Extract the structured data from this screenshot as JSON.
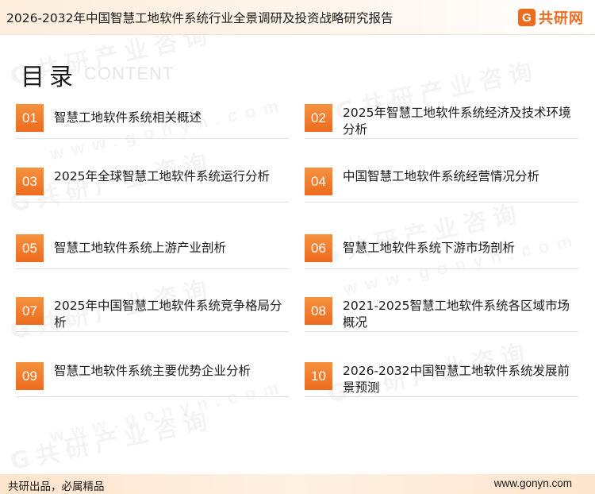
{
  "header": {
    "report_title": "2026-2032年中国智慧工地软件系统行业全景调研及投资战略研究报告",
    "brand_icon_letter": "G",
    "brand_name": "共研网"
  },
  "toc": {
    "heading": "目录",
    "subheading": "CONTENT",
    "items": [
      {
        "num": "01",
        "title": "智慧工地软件系统相关概述"
      },
      {
        "num": "02",
        "title": "2025年智慧工地软件系统经济及技术环境分析"
      },
      {
        "num": "03",
        "title": "2025年全球智慧工地软件系统运行分析"
      },
      {
        "num": "04",
        "title": "中国智慧工地软件系统经营情况分析"
      },
      {
        "num": "05",
        "title": "智慧工地软件系统上游产业剖析"
      },
      {
        "num": "06",
        "title": "智慧工地软件系统下游市场剖析"
      },
      {
        "num": "07",
        "title": "2025年中国智慧工地软件系统竞争格局分析"
      },
      {
        "num": "08",
        "title": "2021-2025智慧工地软件系统各区域市场概况"
      },
      {
        "num": "09",
        "title": "智慧工地软件系统主要优势企业分析"
      },
      {
        "num": "10",
        "title": "2026-2032中国智慧工地软件系统发展前景预测"
      }
    ]
  },
  "watermark": {
    "text": "G共研产业咨询",
    "url": "www.gonyn.com"
  },
  "footer": {
    "slogan": "共研出品，必属精品",
    "url": "www.gonyn.com"
  },
  "colors": {
    "accent": "#ee6b1e",
    "accent_light": "#f5923e",
    "header_bg": "#fdeedd",
    "footer_bg": "#fde4cc"
  }
}
